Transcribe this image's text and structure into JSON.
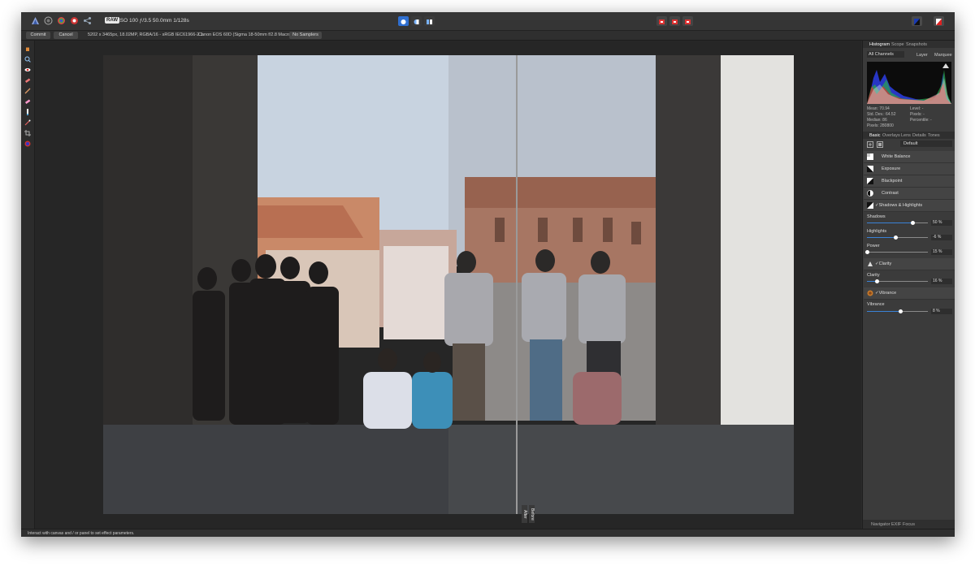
{
  "topbar": {
    "raw_badge": "RAW",
    "camera_info": "ISO 100 ƒ/3.5 50.0mm 1/128s"
  },
  "context": {
    "commit": "Commit",
    "cancel": "Cancel",
    "image_info": "5202 x 3465px, 18.02MP, RGBA/16 - sRGB IEC61966-2.1",
    "lens_info": "Canon EOS 60D (Sigma 18-50mm f/2.8 Macro)",
    "no_samplers": "No Samplers"
  },
  "canvas": {
    "after_label": "After",
    "before_label": "Before"
  },
  "panel": {
    "tabs": [
      "Histogram",
      "Scope",
      "Snapshots"
    ],
    "channel_select": "All Channels",
    "layer_opt": "Layer",
    "marquee_opt": "Marquee",
    "stats": {
      "mean": "Mean: 70.94",
      "std": "Std. Dev.: 64.52",
      "median": "Median: 86",
      "pixels": "Pixels: 280800",
      "level": "Level: -",
      "count": "Pixels: -",
      "percentile": "Percentile: -"
    },
    "adj_tabs": [
      "Basic",
      "Overlays",
      "Lens",
      "Details",
      "Tones"
    ],
    "preset": "Default",
    "rows": {
      "white_balance": "White Balance",
      "exposure": "Exposure",
      "blackpoint": "Blackpoint",
      "contrast": "Contrast",
      "shadows_highlights": "Shadows & Highlights",
      "clarity": "Clarity",
      "vibrance": "Vibrance"
    },
    "sliders": {
      "shadows": {
        "label": "Shadows",
        "value": "50 %",
        "level": 0.75
      },
      "highlights": {
        "label": "Highlights",
        "value": "-6 %",
        "level": 0.47
      },
      "power": {
        "label": "Power",
        "value": "15 %",
        "level": 0.0
      },
      "clarity": {
        "label": "Clarity",
        "value": "16 %",
        "level": 0.16
      },
      "vibrance": {
        "label": "Vibrance",
        "value": "8 %",
        "level": 0.54
      }
    },
    "bottom_tabs": [
      "Navigator",
      "EXIF",
      "Focus"
    ]
  },
  "status": {
    "text": "Interact with canvas and / or panel to set effect parameters."
  },
  "colors": {
    "accent": "#3a82d6",
    "window_bg": "#2a2a2a",
    "panel_bg": "#3b3b3b"
  }
}
